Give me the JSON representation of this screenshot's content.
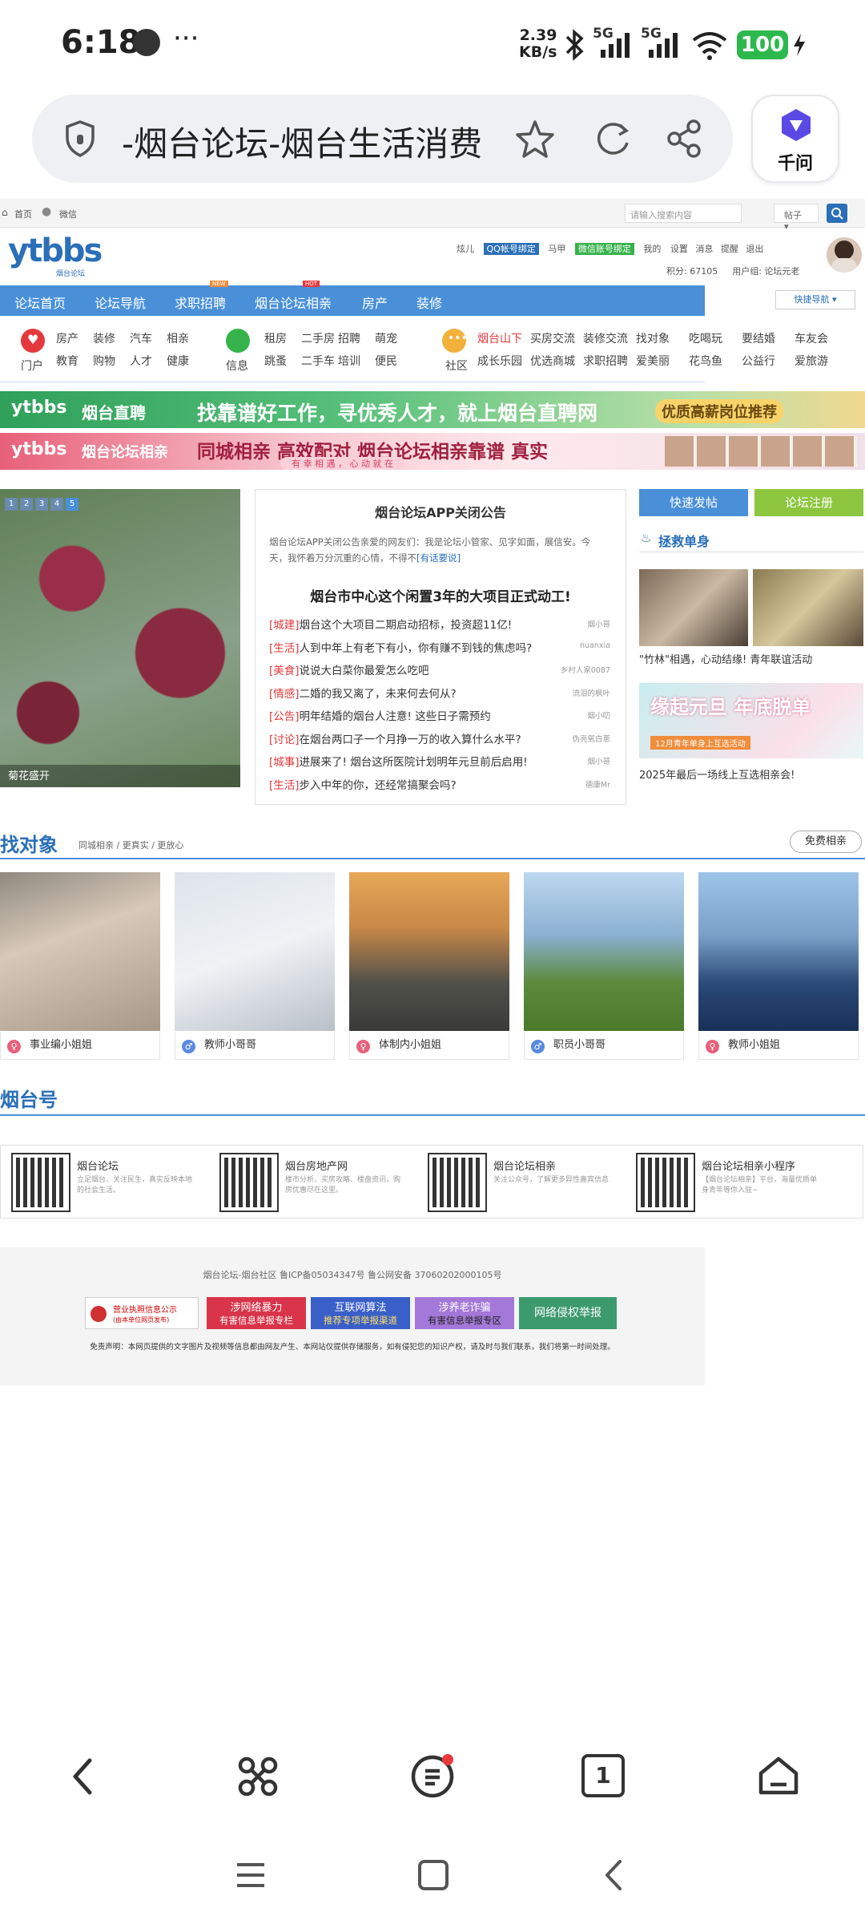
{
  "status": {
    "time": "6:18",
    "more": "···",
    "speed_top": "2.39",
    "speed_unit": "KB/s",
    "network1": "5G",
    "network2": "5G",
    "wifi_sub": "7",
    "battery": "100"
  },
  "browser": {
    "title": "-烟台论坛-烟台生活消费",
    "assistant_label": "千问"
  },
  "site": {
    "topbar": {
      "home": "首页",
      "wechat": "微信",
      "search_placeholder": "请输入搜索内容",
      "search_scope": "帖子"
    },
    "logo_text": "ytbbs",
    "logo_sub": "烟台论坛",
    "user": {
      "name": "炫儿",
      "qq_bind": "QQ帐号绑定",
      "horse": "马甲",
      "wechat_bind": "微信账号绑定",
      "mine": "我的",
      "settings": "设置",
      "messages": "消息",
      "remind": "提醒",
      "logout": "退出",
      "points": "积分: 67105",
      "group": "用户组: 论坛元老"
    },
    "nav": [
      "论坛首页",
      "论坛导航",
      "求职招聘",
      "烟台论坛相亲",
      "房产",
      "装修"
    ],
    "nav_badges": {
      "new": "NEW",
      "hot": "HOT"
    },
    "quick_nav": "快捷导航",
    "sub_groups": {
      "g1_label": "门户",
      "g1": [
        [
          "房产",
          "装修",
          "汽车",
          "相亲"
        ],
        [
          "教育",
          "购物",
          "人才",
          "健康"
        ]
      ],
      "g2_label": "信息",
      "g2": [
        [
          "租房",
          "二手房",
          "招聘",
          "萌宠"
        ],
        [
          "跳蚤",
          "二手车",
          "培训",
          "便民"
        ]
      ],
      "g3_label": "社区",
      "g3": [
        [
          "烟台山下",
          "买房交流",
          "装修交流",
          "找对象",
          "吃喝玩",
          "要结婚",
          "车友会"
        ],
        [
          "成长乐园",
          "优选商城",
          "求职招聘",
          "爱美丽",
          "花鸟鱼",
          "公益行",
          "爱旅游"
        ]
      ]
    },
    "banner1": {
      "brand": "ytbbs",
      "name": "烟台直聘",
      "slogan": "找靠谱好工作，寻优秀人才，就上烟台直聘网",
      "cta": "优质高薪岗位推荐"
    },
    "banner2": {
      "brand": "ytbbs",
      "name": "烟台论坛相亲",
      "slogan": "同城相亲 高效配对  烟台论坛相亲靠谱 真实",
      "tagline": "有 幸 相 遇 ， 心 动 就 在"
    },
    "slider": {
      "pages": [
        "1",
        "2",
        "3",
        "4",
        "5"
      ],
      "caption": "菊花盛开"
    },
    "notice": {
      "title": "烟台论坛APP关闭公告",
      "body": "烟台论坛APP关闭公告亲爱的网友们：我是论坛小管家、见字如面，展信安。今天，我怀着万分沉重的心情，不得不",
      "more": "[有话要说]"
    },
    "headline": "烟台市中心这个闲置3年的大项目正式动工!",
    "news": [
      {
        "tag": "[城建]",
        "text": "烟台这个大项目二期启动招标，投资超11亿!",
        "author": "烟小哥"
      },
      {
        "tag": "[生活]",
        "text": "人到中年上有老下有小，你有赚不到钱的焦虑吗?",
        "author": "nuanxia"
      },
      {
        "tag": "[美食]",
        "text": "说说大白菜你最爱怎么吃吧",
        "author": "乡村人家0087"
      },
      {
        "tag": "[情感]",
        "text": "二婚的我又离了，未来何去何从?",
        "author": "流泪的枫叶"
      },
      {
        "tag": "[公告]",
        "text": "明年结婚的烟台人注意! 这些日子需预约",
        "author": "烟小叨"
      },
      {
        "tag": "[讨论]",
        "text": "在烟台两口子一个月挣一万的收入算什么水平?",
        "author": "伪亮氧白蔥"
      },
      {
        "tag": "[城事]",
        "text": "进展来了! 烟台这所医院计划明年元旦前后启用!",
        "author": "烟小哥"
      },
      {
        "tag": "[生活]",
        "text": "步入中年的你，还经常搞聚会吗?",
        "author": "德康Mr"
      }
    ],
    "right": {
      "post": "快速发帖",
      "register": "论坛注册",
      "section": "拯救单身",
      "cap1": "\"竹林\"相遇，心动结缘! 青年联谊活动",
      "promo_big": "缘起元旦 年底脱单",
      "promo_small": "12月青年单身上互选活动",
      "cap2": "2025年最后一场线上互选相亲会!"
    },
    "match": {
      "title": "找对象",
      "sub": "同城相亲 / 更真实 / 更放心",
      "button": "免费相亲",
      "people": [
        {
          "label": "事业编小姐姐",
          "gender": "female"
        },
        {
          "label": "教师小哥哥",
          "gender": "male"
        },
        {
          "label": "体制内小姐姐",
          "gender": "female"
        },
        {
          "label": "职员小哥哥",
          "gender": "male"
        },
        {
          "label": "教师小姐姐",
          "gender": "female"
        }
      ]
    },
    "accounts": {
      "title": "烟台号",
      "items": [
        {
          "name": "烟台论坛",
          "desc": "立足烟台、关注民生，真实反映本地的社会生活。"
        },
        {
          "name": "烟台房地产网",
          "desc": "楼市分析、买房攻略、楼盘资讯，购房优惠尽在这里。"
        },
        {
          "name": "烟台论坛相亲",
          "desc": "关注公众号，了解更多异性嘉宾信息"
        },
        {
          "name": "烟台论坛相亲小程序",
          "desc": "【烟台论坛相亲】平台，海量优质单身青年等你入驻~"
        }
      ]
    },
    "footer": {
      "icp": "烟台论坛-烟台社区 鲁ICP备05034347号 鲁公网安备 37060202000105号",
      "badge1": "营业执照信息公示",
      "badge1_sub": "(由本单位网页发布)",
      "badge2a": "涉网络暴力",
      "badge2b": "有害信息举报专栏",
      "badge3a": "互联网算法",
      "badge3b": "推荐专项举报渠道",
      "badge4a": "涉养老诈骗",
      "badge4b": "有害信息举报专区",
      "badge5": "网络侵权举报",
      "disclaimer": "免责声明：本网页提供的文字图片及视频等信息都由网友产生、本网站仅提供存储服务，如有侵犯您的知识产权，请及时与我们联系，我们将第一时间处理。"
    }
  },
  "bottom_nav": {
    "tab_count": "1"
  },
  "colors": {
    "nav_blue": "#4a90d9",
    "accent_red": "#e4393c",
    "register_green": "#8cc63f",
    "post_blue": "#4a90d9"
  }
}
